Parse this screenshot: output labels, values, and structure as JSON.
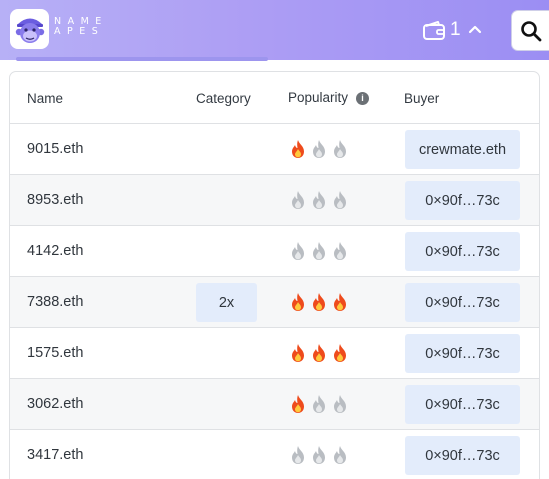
{
  "header": {
    "logo_text": "NAME APES",
    "wallet_count": "1",
    "colors": {
      "gradient_start": "#b7b0f6",
      "gradient_end": "#9b8ef3"
    }
  },
  "table": {
    "columns": {
      "name": "Name",
      "category": "Category",
      "popularity": "Popularity",
      "buyer": "Buyer"
    },
    "rows": [
      {
        "name": "9015.eth",
        "category": "",
        "flames": [
          1,
          0,
          0
        ],
        "buyer": "crewmate.eth"
      },
      {
        "name": "8953.eth",
        "category": "",
        "flames": [
          0,
          0,
          0
        ],
        "buyer": "0×90f…73c"
      },
      {
        "name": "4142.eth",
        "category": "",
        "flames": [
          0,
          0,
          0
        ],
        "buyer": "0×90f…73c"
      },
      {
        "name": "7388.eth",
        "category": "2x",
        "flames": [
          1,
          1,
          1
        ],
        "buyer": "0×90f…73c"
      },
      {
        "name": "1575.eth",
        "category": "",
        "flames": [
          1,
          1,
          1
        ],
        "buyer": "0×90f…73c"
      },
      {
        "name": "3062.eth",
        "category": "",
        "flames": [
          1,
          0,
          0
        ],
        "buyer": "0×90f…73c"
      },
      {
        "name": "3417.eth",
        "category": "",
        "flames": [
          0,
          0,
          0
        ],
        "buyer": "0×90f…73c"
      }
    ]
  },
  "icons": {
    "logo": "ape-logo-icon",
    "wallet": "wallet-icon",
    "toggle": "chevron-up-icon",
    "search": "search-icon",
    "info": "info-icon",
    "flame": "flame-icon"
  },
  "colors": {
    "flame_active": "#ee4b1c",
    "flame_inactive": "#b9bdc2",
    "chip_bg": "#e3ecfb"
  }
}
